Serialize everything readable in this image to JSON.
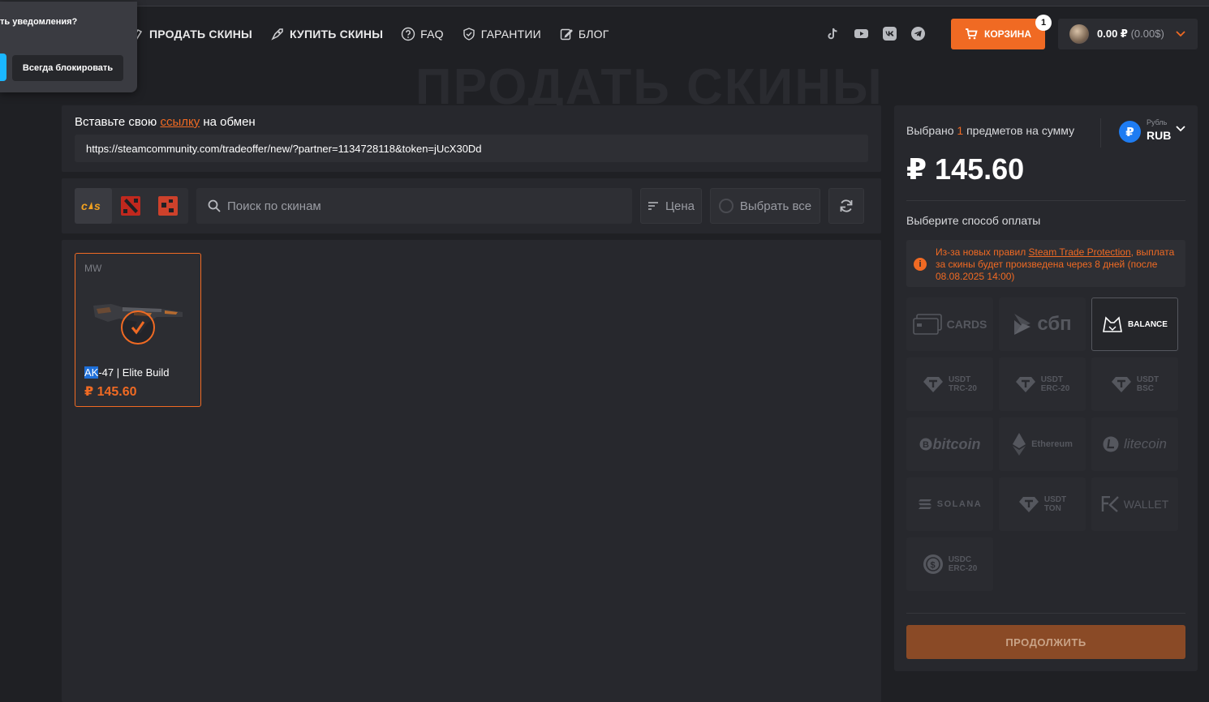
{
  "notification": {
    "title": "ть уведомления?",
    "block_label": "Всегда блокировать"
  },
  "nav": {
    "sell": "ПРОДАТЬ СКИНЫ",
    "buy": "КУПИТЬ СКИНЫ",
    "faq": "FAQ",
    "guarantees": "ГАРАНТИИ",
    "blog": "БЛОГ"
  },
  "cart": {
    "label": "КОРЗИНА",
    "count": "1"
  },
  "balance": {
    "rub": "0.00 ₽",
    "usd": "(0.00$)"
  },
  "page_title": "ПРОДАТЬ СКИНЫ",
  "trade": {
    "label_before": "Вставьте свою",
    "label_link": "ссылку",
    "label_after": "на обмен",
    "url": "https://steamcommunity.com/tradeoffer/new/?partner=1134728118&token=jUcX30Dd"
  },
  "filters": {
    "search_placeholder": "Поиск по скинам",
    "price_label": "Цена",
    "select_all_label": "Выбрать все"
  },
  "items": [
    {
      "wear": "MW",
      "name_highlight": "AK",
      "name_rest": "-47 | Elite Build",
      "price": "₽ 145.60"
    }
  ],
  "summary": {
    "selected_before": "Выбрано",
    "selected_count": "1",
    "selected_after": "предметов на сумму",
    "currency_small": "Рубль",
    "currency_code": "RUB",
    "currency_symbol": "₽",
    "total": "₽ 145.60",
    "payment_label": "Выберите способ оплаты",
    "warning_before": "Из-за новых правил",
    "warning_link": "Steam Trade Protection",
    "warning_after": ", выплата за скины будет произведена через 8 дней (после 08.08.2025 14:00)",
    "continue_label": "ПРОДОЛЖИТЬ"
  },
  "payments": {
    "cards": "CARDS",
    "sbp": "сбп",
    "balance": "BALANCE",
    "usdt_trc_1": "USDT",
    "usdt_trc_2": "TRC-20",
    "usdt_erc_1": "USDT",
    "usdt_erc_2": "ERC-20",
    "usdt_bsc_1": "USDT",
    "usdt_bsc_2": "BSC",
    "bitcoin": "bitcoin",
    "ethereum": "Ethereum",
    "litecoin": "litecoin",
    "solana": "SOLANA",
    "usdt_ton_1": "USDT",
    "usdt_ton_2": "TON",
    "fkwallet": "WALLET",
    "usdc_1": "USDC",
    "usdc_2": "ERC-20"
  },
  "colors": {
    "accent": "#f06a23",
    "bg": "#1f2024",
    "panel": "#27282d",
    "coin": "#1e7cf2"
  }
}
